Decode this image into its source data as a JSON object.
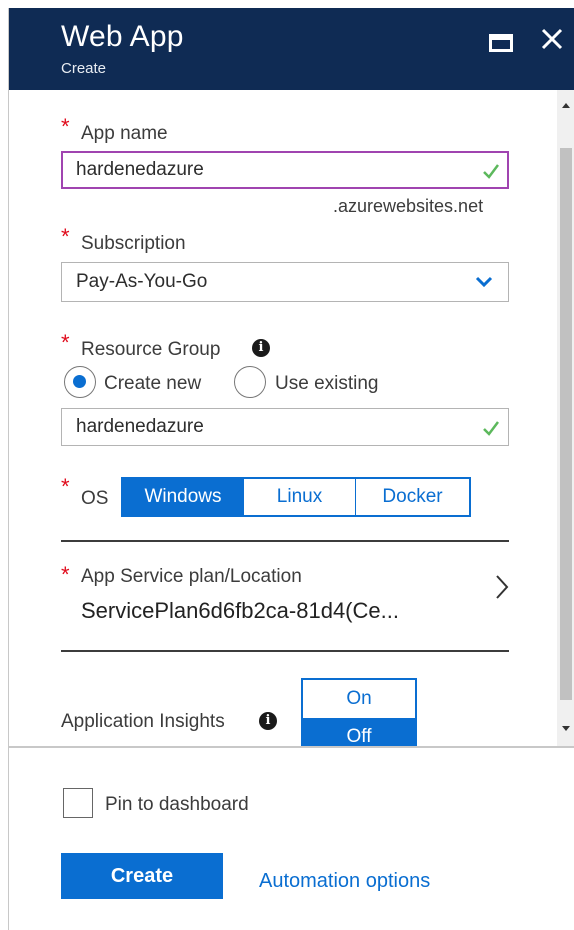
{
  "header": {
    "title": "Web App",
    "subtitle": "Create",
    "bg_color": "#0f2b54"
  },
  "form": {
    "app_name": {
      "label": "App name",
      "value": "hardenedazure",
      "suffix": ".azurewebsites.net",
      "valid": true
    },
    "subscription": {
      "label": "Subscription",
      "selected": "Pay-As-You-Go"
    },
    "resource_group": {
      "label": "Resource Group",
      "options": [
        "Create new",
        "Use existing"
      ],
      "selected_option": "Create new",
      "value": "hardenedazure",
      "valid": true
    },
    "os": {
      "label": "OS",
      "options": [
        "Windows",
        "Linux",
        "Docker"
      ],
      "selected": "Windows"
    },
    "service_plan": {
      "label": "App Service plan/Location",
      "value": "ServicePlan6d6fb2ca-81d4(Ce..."
    },
    "app_insights": {
      "label": "Application Insights",
      "options": [
        "On",
        "Off"
      ],
      "selected": "Off"
    }
  },
  "footer": {
    "pin_label": "Pin to dashboard",
    "pin_checked": false,
    "create_label": "Create",
    "automation_label": "Automation options"
  },
  "colors": {
    "accent": "#0a6ed1",
    "required": "#e00b1c",
    "valid_check": "#5cb85c",
    "focus_border": "#a044b0"
  }
}
